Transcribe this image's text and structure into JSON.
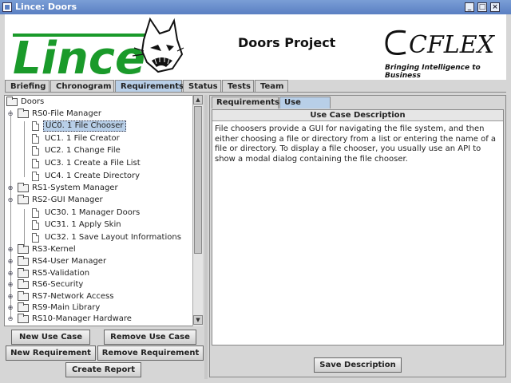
{
  "window": {
    "title": "Lince: Doors"
  },
  "header": {
    "logo_left": "Lince",
    "project_title": "Doors Project",
    "logo_right": "CFLEX",
    "logo_right_tagline": "Bringing Intelligence to Business"
  },
  "main_tabs": [
    {
      "label": "Briefing",
      "active": false
    },
    {
      "label": "Chronogram",
      "active": false
    },
    {
      "label": "Requirements",
      "active": true
    },
    {
      "label": "Status",
      "active": false
    },
    {
      "label": "Tests",
      "active": false
    },
    {
      "label": "Team",
      "active": false
    }
  ],
  "tree": {
    "root": "Doors",
    "nodes": [
      {
        "label": "RS0-File Manager",
        "type": "folder",
        "expanded": true
      },
      {
        "label": "UC0. 1 File Chooser",
        "type": "leaf",
        "selected": true
      },
      {
        "label": "UC1. 1 File Creator",
        "type": "leaf"
      },
      {
        "label": "UC2. 1 Change File",
        "type": "leaf"
      },
      {
        "label": "UC3. 1 Create a File List",
        "type": "leaf"
      },
      {
        "label": "UC4. 1 Create Directory",
        "type": "leaf"
      },
      {
        "label": "RS1-System Manager",
        "type": "folder"
      },
      {
        "label": "RS2-GUI Manager",
        "type": "folder",
        "expanded": true
      },
      {
        "label": "UC30. 1 Manager Doors",
        "type": "leaf"
      },
      {
        "label": "UC31. 1 Apply Skin",
        "type": "leaf"
      },
      {
        "label": "UC32. 1 Save Layout Informations",
        "type": "leaf"
      },
      {
        "label": "RS3-Kernel",
        "type": "folder"
      },
      {
        "label": "RS4-User Manager",
        "type": "folder"
      },
      {
        "label": "RS5-Validation",
        "type": "folder"
      },
      {
        "label": "RS6-Security",
        "type": "folder"
      },
      {
        "label": "RS7-Network Access",
        "type": "folder"
      },
      {
        "label": "RS9-Main Library",
        "type": "folder"
      },
      {
        "label": "RS10-Manager Hardware",
        "type": "folder",
        "expanded": true
      }
    ]
  },
  "buttons": {
    "new_use_case": "New Use Case",
    "remove_use_case": "Remove Use Case",
    "new_requirement": "New Requirement",
    "remove_requirement": "Remove Requirement",
    "create_report": "Create Report",
    "save_description": "Save Description"
  },
  "right_tabs": [
    {
      "label": "Requirements",
      "active": false
    },
    {
      "label": "Use Cases",
      "active": true
    }
  ],
  "description": {
    "header": "Use Case Description",
    "text": "File choosers provide a GUI for navigating the file system, and then either choosing a file or directory from a list or entering the name of a file or directory. To display a file chooser, you usually use an API to show a modal dialog containing the file chooser."
  },
  "colors": {
    "title_bar": "#5a7fc2",
    "active_tab": "#b8cfe8",
    "lince_green": "#1a9a2a"
  }
}
